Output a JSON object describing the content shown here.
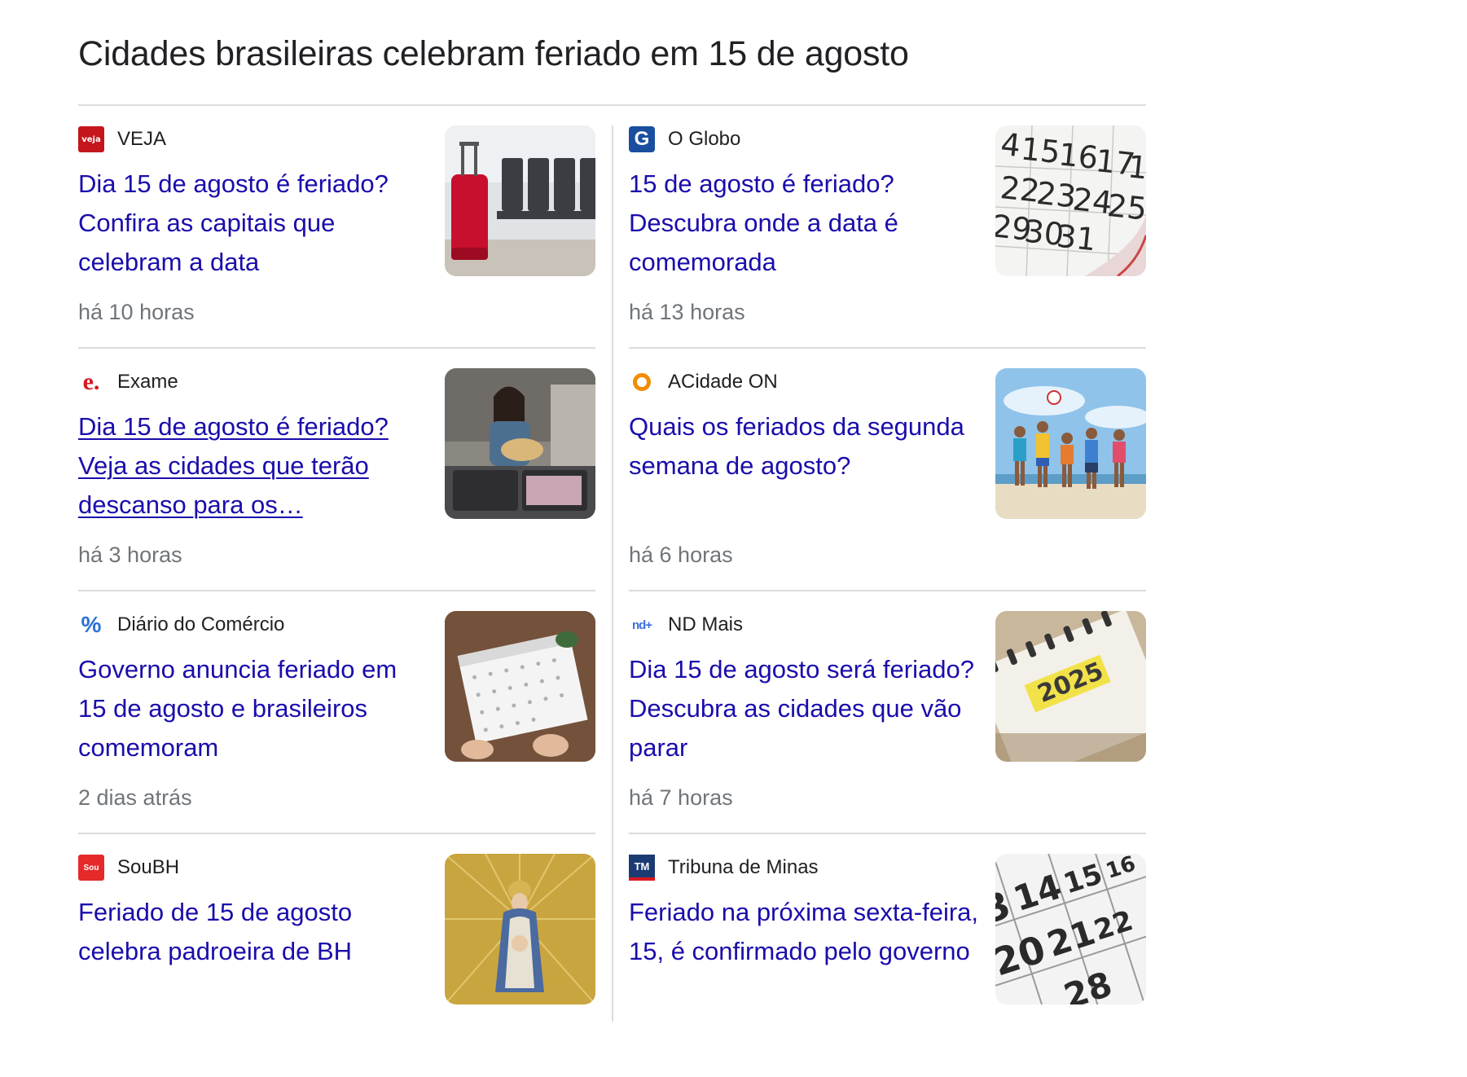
{
  "headline": "Cidades brasileiras celebram feriado em 15 de agosto",
  "articles": [
    {
      "source": "VEJA",
      "logo_text": "veja",
      "logo_color": "#c4161c",
      "title": "Dia 15 de agosto é feriado? Confira as capitais que celebram a data",
      "time": "há 10 horas",
      "thumbnail": "airport-suitcase"
    },
    {
      "source": "O Globo",
      "logo_text": "G",
      "logo_color": "#1a4fa0",
      "title": "15 de agosto é feriado? Descubra onde a data é comemorada",
      "time": "há 13 horas",
      "thumbnail": "calendar-page"
    },
    {
      "source": "Exame",
      "logo_text": "e.",
      "logo_color": "#d71921",
      "title": "Dia 15 de agosto é feriado? Veja as cidades que terão descanso para os…",
      "time": "há 3 horas",
      "thumbnail": "woman-packing"
    },
    {
      "source": "ACidade ON",
      "logo_text": "",
      "logo_color": "#f28c00",
      "title": "Quais os feriados da segunda semana de agosto?",
      "time": "há 6 horas",
      "thumbnail": "beach-volleyball"
    },
    {
      "source": "Diário do Comércio",
      "logo_text": "%",
      "logo_color": "#2a6fd6",
      "title": "Governo anuncia feriado em 15 de agosto e brasileiros comemoram",
      "time": "2 dias atrás",
      "thumbnail": "desk-calendar"
    },
    {
      "source": "ND Mais",
      "logo_text": "nd+",
      "logo_color": "#3d6fe0",
      "title": "Dia 15 de agosto será feriado? Descubra as cidades que vão parar",
      "time": "há 7 horas",
      "thumbnail": "calendar-2025"
    },
    {
      "source": "SouBH",
      "logo_text": "Sou",
      "logo_color": "#e52a2a",
      "title": "Feriado de 15 de agosto celebra padroeira de BH",
      "time": "",
      "thumbnail": "saint-statue"
    },
    {
      "source": "Tribuna de Minas",
      "logo_text": "TM",
      "logo_color": "#1c3b73",
      "title": "Feriado na próxima sexta-feira, 15, é confirmado pelo governo",
      "time": "",
      "thumbnail": "calendar-numbers"
    }
  ],
  "colors": {
    "link": "#1a0dab",
    "meta": "#70757a",
    "divider": "#dadce0"
  }
}
